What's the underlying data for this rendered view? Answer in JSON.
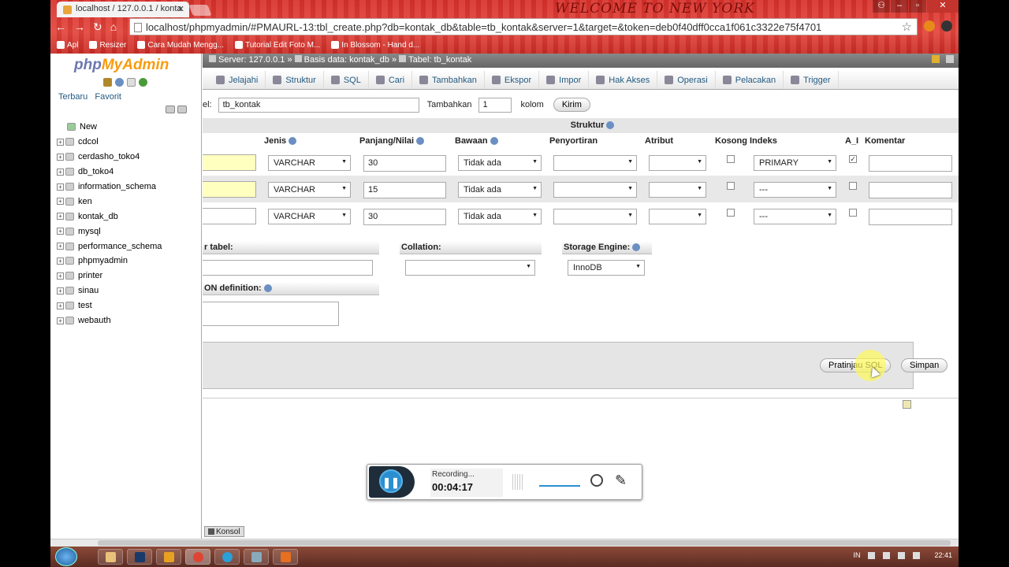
{
  "browser": {
    "tab_title": "localhost / 127.0.0.1 / konta",
    "tab_close": "✕",
    "banner": "WELCOME TO NEW YORK",
    "url": "localhost/phpmyadmin/#PMAURL-13:tbl_create.php?db=kontak_db&table=tb_kontak&server=1&target=&token=deb0f40dff0cca1f061c3322e75f4701",
    "bookmarks": [
      "Apl",
      "Resizer",
      "Cara Mudah Mengg...",
      "Tutorial Edit Foto M...",
      "In Blossom - Hand d..."
    ]
  },
  "sidebar": {
    "logo_php": "php",
    "logo_myadmin": "MyAdmin",
    "links": [
      "Terbaru",
      "Favorit"
    ],
    "new_label": "New",
    "databases": [
      "cdcol",
      "cerdasho_toko4",
      "db_toko4",
      "information_schema",
      "ken",
      "kontak_db",
      "mysql",
      "performance_schema",
      "phpmyadmin",
      "printer",
      "sinau",
      "test",
      "webauth"
    ]
  },
  "breadcrumb": {
    "server": "Server: 127.0.0.1",
    "database": "Basis data: kontak_db",
    "table": "Tabel: tb_kontak",
    "sep": "»"
  },
  "tabs": [
    "Jelajahi",
    "Struktur",
    "SQL",
    "Cari",
    "Tambahkan",
    "Ekspor",
    "Impor",
    "Hak Akses",
    "Operasi",
    "Pelacakan",
    "Trigger"
  ],
  "form": {
    "table_label": "el:",
    "table_name": "tb_kontak",
    "add_label": "Tambahkan",
    "add_count": "1",
    "column_label": "kolom",
    "submit": "Kirim"
  },
  "structure": {
    "title": "Struktur",
    "headers": {
      "type": "Jenis",
      "length": "Panjang/Nilai",
      "default": "Bawaan",
      "collation": "Penyortiran",
      "attributes": "Atribut",
      "null": "Kosong",
      "index": "Indeks",
      "ai": "A_I",
      "comment": "Komentar"
    },
    "rows": [
      {
        "type": "VARCHAR",
        "length": "30",
        "default": "Tidak ada",
        "collation": "",
        "attribute": "",
        "null_checked": false,
        "index": "PRIMARY",
        "ai_checked": true,
        "comment": ""
      },
      {
        "type": "VARCHAR",
        "length": "15",
        "default": "Tidak ada",
        "collation": "",
        "attribute": "",
        "null_checked": false,
        "index": "---",
        "ai_checked": false,
        "comment": ""
      },
      {
        "type": "VARCHAR",
        "length": "30",
        "default": "Tidak ada",
        "collation": "",
        "attribute": "",
        "null_checked": false,
        "index": "---",
        "ai_checked": false,
        "comment": ""
      }
    ]
  },
  "table_options": {
    "comment_label": "r tabel:",
    "collation_label": "Collation:",
    "engine_label": "Storage Engine:",
    "engine_value": "InnoDB",
    "partition_label": "ON definition:"
  },
  "actions": {
    "preview": "Pratinjau SQL",
    "save": "Simpan"
  },
  "console_label": "Konsol",
  "recorder": {
    "status": "Recording...",
    "time": "00:04:17"
  },
  "taskbar": {
    "lang": "IN",
    "time": "22:41"
  },
  "colors": {
    "chrome_red": "#d8302a",
    "link_blue": "#235a81",
    "name_field_yellow": "#ffffc0",
    "recorder_blue": "#2a8fd0"
  }
}
